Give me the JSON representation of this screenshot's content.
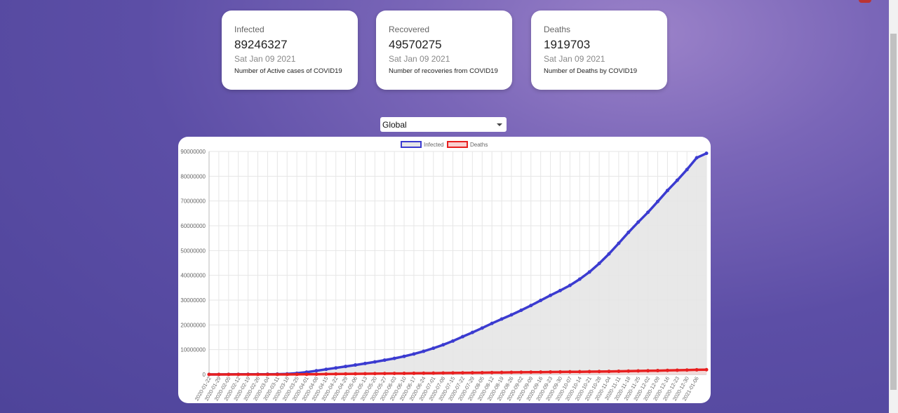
{
  "cards": [
    {
      "label": "Infected",
      "value": "89246327",
      "date": "Sat Jan 09 2021",
      "desc": "Number of Active cases of COVID19"
    },
    {
      "label": "Recovered",
      "value": "49570275",
      "date": "Sat Jan 09 2021",
      "desc": "Number of recoveries from COVID19"
    },
    {
      "label": "Deaths",
      "value": "1919703",
      "date": "Sat Jan 09 2021",
      "desc": "Number of Deaths by COVID19"
    }
  ],
  "selector": {
    "value": "Global"
  },
  "chart_data": {
    "type": "line",
    "ylim": [
      0,
      90000000
    ],
    "yticks": [
      0,
      10000000,
      20000000,
      30000000,
      40000000,
      50000000,
      60000000,
      70000000,
      80000000,
      90000000
    ],
    "ytick_labels": [
      "0",
      "10000000",
      "20000000",
      "30000000",
      "40000000",
      "50000000",
      "60000000",
      "70000000",
      "80000000",
      "90000000"
    ],
    "x_tick_labels": [
      "2020-01-22",
      "2020-01-29",
      "2020-02-05",
      "2020-02-12",
      "2020-02-19",
      "2020-02-26",
      "2020-03-04",
      "2020-03-11",
      "2020-03-18",
      "2020-03-25",
      "2020-04-01",
      "2020-04-08",
      "2020-04-15",
      "2020-04-22",
      "2020-04-29",
      "2020-05-06",
      "2020-05-13",
      "2020-05-20",
      "2020-05-27",
      "2020-06-03",
      "2020-06-10",
      "2020-06-17",
      "2020-06-24",
      "2020-07-01",
      "2020-07-08",
      "2020-07-15",
      "2020-07-22",
      "2020-07-29",
      "2020-08-05",
      "2020-08-12",
      "2020-08-19",
      "2020-08-26",
      "2020-09-02",
      "2020-09-09",
      "2020-09-16",
      "2020-09-23",
      "2020-09-30",
      "2020-10-07",
      "2020-10-14",
      "2020-10-21",
      "2020-10-28",
      "2020-11-04",
      "2020-11-11",
      "2020-11-18",
      "2020-11-25",
      "2020-12-02",
      "2020-12-09",
      "2020-12-16",
      "2020-12-23",
      "2020-12-30",
      "2021-01-06"
    ],
    "legend_position": "top",
    "series": [
      {
        "name": "Infected",
        "color": "#3b3bd0",
        "fill": "#e6e6e6",
        "values": [
          555,
          6166,
          28276,
          45171,
          75204,
          81397,
          95124,
          126702,
          218826,
          467594,
          932605,
          1480202,
          2056924,
          2620357,
          3222530,
          3805420,
          4418617,
          5059736,
          5779390,
          6486580,
          7302434,
          8250931,
          9335829,
          10583452,
          11956713,
          13493837,
          15256001,
          16940843,
          18729493,
          20589651,
          22350011,
          24064032,
          25897622,
          27820349,
          29880632,
          31914133,
          33871574,
          35930120,
          38463045,
          41341628,
          44783458,
          48660508,
          52935002,
          57346028,
          61482447,
          65444926,
          69790034,
          74236502,
          78349321,
          82694518,
          87458320,
          89246327
        ]
      },
      {
        "name": "Deaths",
        "color": "#e82020",
        "fill": "#f8d0d0",
        "values": [
          17,
          133,
          563,
          1118,
          2009,
          2770,
          3286,
          4615,
          8790,
          21357,
          47192,
          88333,
          134569,
          178546,
          227705,
          263830,
          295101,
          324549,
          355627,
          382467,
          410282,
          443761,
          479884,
          516210,
          557294,
          597650,
          638574,
          678811,
          718982,
          760011,
          799349,
          837880,
          873734,
          910022,
          943927,
          980225,
          1015000,
          1050011,
          1087190,
          1125880,
          1168810,
          1220000,
          1280290,
          1339920,
          1404050,
          1472030,
          1540620,
          1614830,
          1690850,
          1762870,
          1861610,
          1919703
        ]
      }
    ]
  }
}
